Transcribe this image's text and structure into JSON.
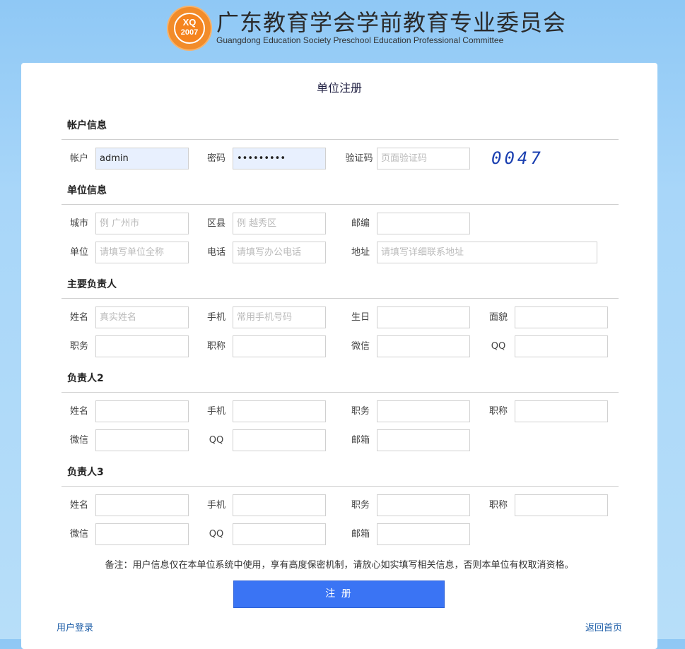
{
  "brand": {
    "logo_text": "XQ",
    "logo_year": "2007",
    "title_cn": "广东教育学会学前教育专业委员会",
    "title_en": "Guangdong Education Society Preschool Education Professional Committee"
  },
  "page_title": "单位注册",
  "sections": {
    "account": {
      "title": "帐户信息",
      "user_label": "帐户",
      "user_value": "admin",
      "pwd_label": "密码",
      "pwd_value": "•••••••••",
      "captcha_label": "验证码",
      "captcha_placeholder": "页面验证码",
      "captcha_code": "0047"
    },
    "unit": {
      "title": "单位信息",
      "city_label": "城市",
      "city_placeholder": "例 广州市",
      "district_label": "区县",
      "district_placeholder": "例 越秀区",
      "zip_label": "邮编",
      "unit_label": "单位",
      "unit_placeholder": "请填写单位全称",
      "phone_label": "电话",
      "phone_placeholder": "请填写办公电话",
      "addr_label": "地址",
      "addr_placeholder": "请填写详细联系地址"
    },
    "lead": {
      "title": "主要负责人",
      "name_label": "姓名",
      "name_placeholder": "真实姓名",
      "mobile_label": "手机",
      "mobile_placeholder": "常用手机号码",
      "birthday_label": "生日",
      "politics_label": "面貌",
      "duty_label": "职务",
      "rank_label": "职称",
      "wechat_label": "微信",
      "qq_label": "QQ"
    },
    "lead2": {
      "title": "负责人2",
      "name_label": "姓名",
      "mobile_label": "手机",
      "duty_label": "职务",
      "rank_label": "职称",
      "wechat_label": "微信",
      "qq_label": "QQ",
      "email_label": "邮箱"
    },
    "lead3": {
      "title": "负责人3",
      "name_label": "姓名",
      "mobile_label": "手机",
      "duty_label": "职务",
      "rank_label": "职称",
      "wechat_label": "微信",
      "qq_label": "QQ",
      "email_label": "邮箱"
    }
  },
  "note": "备注：用户信息仅在本单位系统中使用，享有高度保密机制，请放心如实填写相关信息，否则本单位有权取消资格。",
  "submit_label": "注 册",
  "links": {
    "login": "用户登录",
    "home": "返回首页"
  },
  "colors": {
    "accent": "#3a74f4",
    "logo": "#f5841f"
  }
}
